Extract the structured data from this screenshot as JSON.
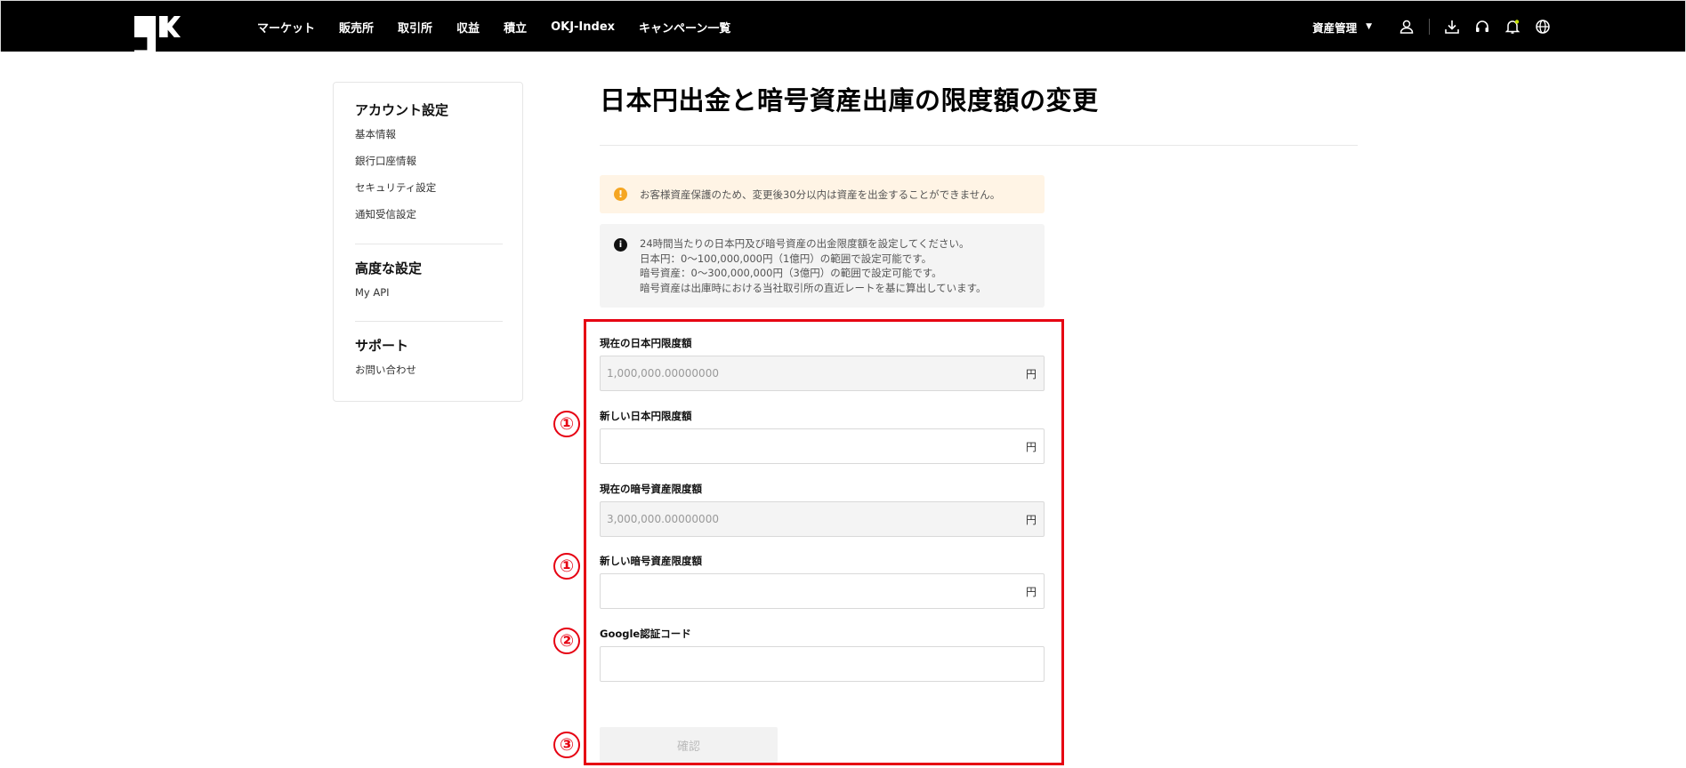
{
  "nav": {
    "logo_alt": "OKJ",
    "links": [
      "マーケット",
      "販売所",
      "取引所",
      "収益",
      "積立",
      "OKJ-Index",
      "キャンペーン一覧"
    ],
    "asset_menu": "資産管理"
  },
  "sidebar": {
    "sections": [
      {
        "title": "アカウント設定",
        "items": [
          "基本情報",
          "銀行口座情報",
          "セキュリティ設定",
          "通知受信設定"
        ]
      },
      {
        "title": "高度な設定",
        "items": [
          "My API"
        ]
      },
      {
        "title": "サポート",
        "items": [
          "お問い合わせ"
        ]
      }
    ]
  },
  "page": {
    "title": "日本円出金と暗号資産出庫の限度額の変更",
    "warning": "お客様資産保護のため、変更後30分以内は資産を出金することができません。",
    "info_lines": [
      "24時間当たりの日本円及び暗号資産の出金限度額を設定してください。",
      "日本円：0〜100,000,000円（1億円）の範囲で設定可能です。",
      "暗号資産：0〜300,000,000円（3億円）の範囲で設定可能です。",
      "暗号資産は出庫時における当社取引所の直近レートを基に算出しています。"
    ]
  },
  "form": {
    "current_jpy_label": "現在の日本円限度額",
    "current_jpy_value": "1,000,000.00000000",
    "new_jpy_label": "新しい日本円限度額",
    "current_crypto_label": "現在の暗号資産限度額",
    "current_crypto_value": "3,000,000.00000000",
    "new_crypto_label": "新しい暗号資産限度額",
    "google_label": "Google認証コード",
    "unit": "円",
    "confirm": "確認"
  },
  "annotations": {
    "marker1": "①",
    "marker2": "②",
    "marker3": "③",
    "frame_color": "#e60012"
  }
}
